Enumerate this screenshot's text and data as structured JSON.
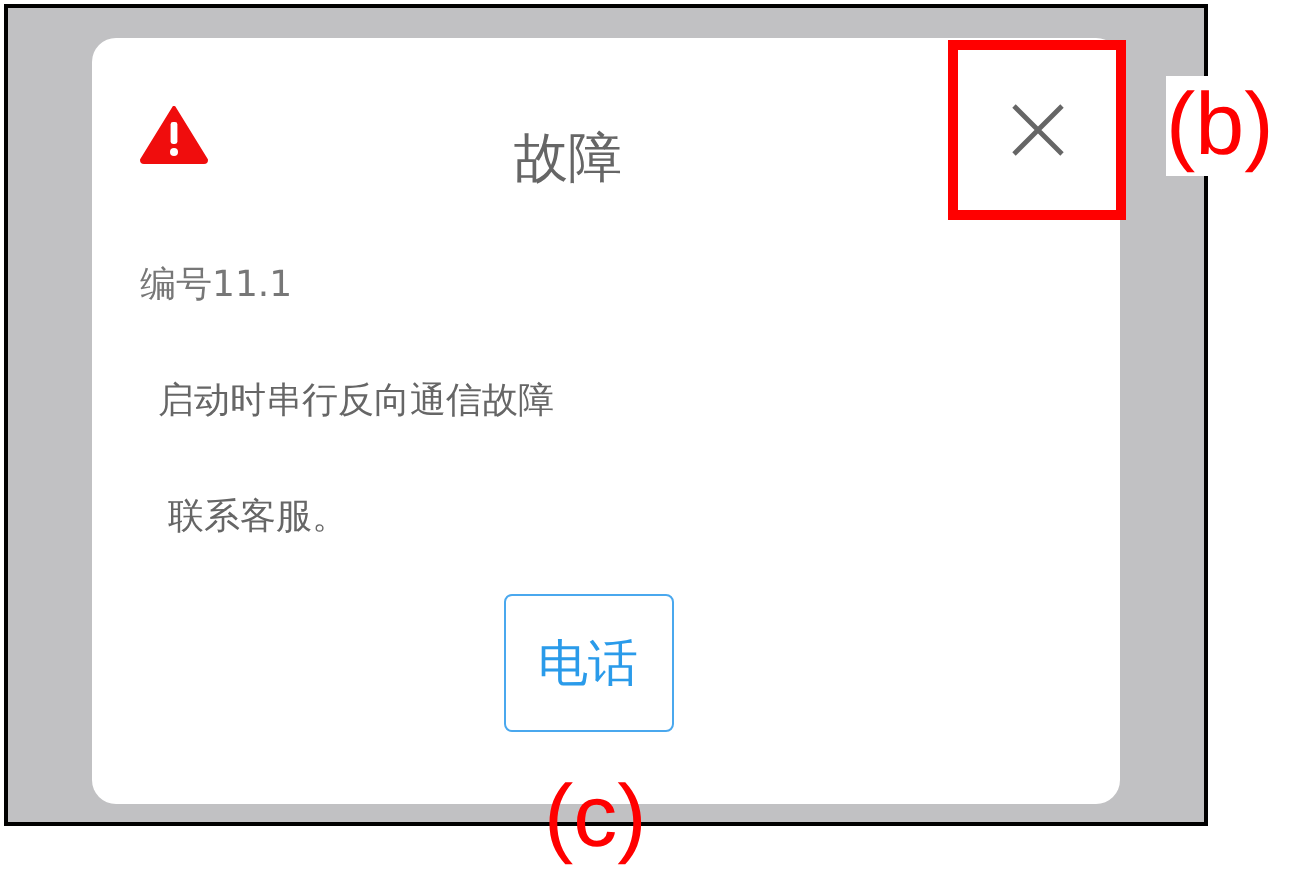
{
  "dialog": {
    "title": "故障",
    "code": "编号11.1",
    "message": "启动时串行反向通信故障",
    "instruction": "联系客服。",
    "button": "电话"
  },
  "annotations": {
    "close_button": "(b)",
    "call_button": "(c)"
  }
}
